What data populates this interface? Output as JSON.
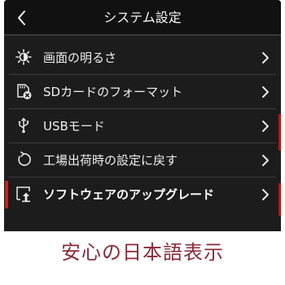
{
  "header": {
    "title": "システム設定",
    "back_glyph": "<"
  },
  "menu": {
    "items": [
      {
        "label": "画面の明るさ",
        "icon": "brightness-icon",
        "selected": false
      },
      {
        "label": "SDカードのフォーマット",
        "icon": "sd-card-format-icon",
        "selected": false
      },
      {
        "label": "USBモード",
        "icon": "usb-icon",
        "selected": false
      },
      {
        "label": "工場出荷時の設定に戻す",
        "icon": "reset-icon",
        "selected": false
      },
      {
        "label": "ソフトウェアのアップグレード",
        "icon": "software-upgrade-icon",
        "selected": true
      }
    ],
    "selected_index": 4
  },
  "caption": "安心の日本語表示",
  "colors": {
    "screen_bg": "#1c1c1c",
    "header_bg": "#111111",
    "text": "#efefef",
    "selection_accent": "#e01515",
    "caption_text": "#8a2a3a"
  }
}
